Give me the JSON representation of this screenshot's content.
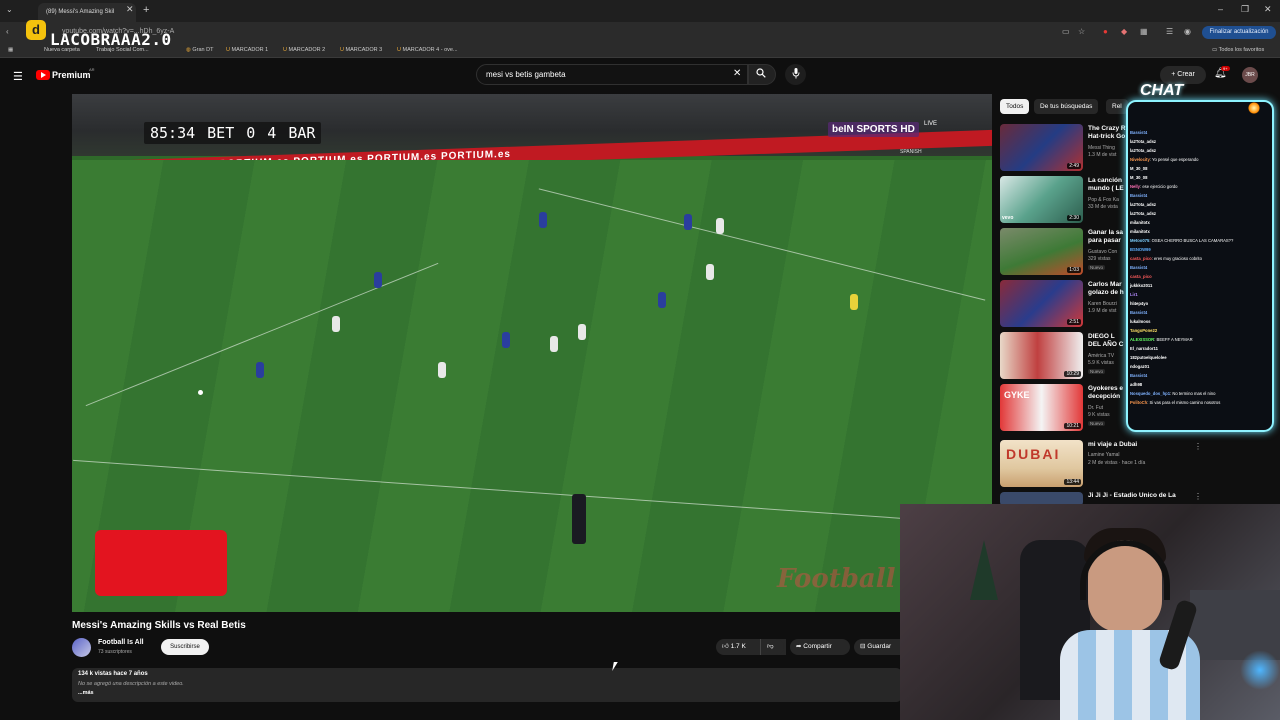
{
  "browser": {
    "tab_title": "(89) Messi's Amazing Skil",
    "url": "youtube.com/watch?v=...hDh_6yz-A",
    "update_button": "Finalizar actualización",
    "bookmarks": [
      {
        "label": "Nueva carpeta"
      },
      {
        "label": "Trabajo Social Com..."
      },
      {
        "label": "Gran DT"
      },
      {
        "label": "MARCADOR 1"
      },
      {
        "label": "MARCADOR 2"
      },
      {
        "label": "MARCADOR 3"
      },
      {
        "label": "MARCADOR 4 - ove..."
      }
    ],
    "all_bookmarks": "Todos los favoritos"
  },
  "stream": {
    "logo_letter": "d",
    "name": "LACOBRAAA2.0"
  },
  "header": {
    "brand": "Premium",
    "country": "AR",
    "search_value": "mesi vs betis gambeta",
    "create_label": "Crear",
    "notification_count": "9+",
    "avatar_initials": "JBR"
  },
  "video": {
    "scoreboard": {
      "time": "85:34",
      "home": "BET",
      "home_score": "0",
      "away_score": "4",
      "away": "BAR"
    },
    "broadcaster": "beIN SPORTS HD",
    "broadcaster_live": "LIVE",
    "broadcaster_sub": "SPANISH",
    "adboard": "PORTIUM.es    PORTIUM.es    PORTIUM.es    PORTIUM.es    PORTIUM.es    PORTIUM.es",
    "watermark": "Football",
    "title": "Messi's Amazing Skills vs Real Betis",
    "channel": "Football Is All",
    "subscribers": "73 suscriptores",
    "subscribe_label": "Suscribirse",
    "likes": "1.7 K",
    "share_label": "Compartir",
    "save_label": "Guardar",
    "stats": "134 k vistas  hace 7 años",
    "description": "No se agregó una descripción a este video.",
    "more": "...más"
  },
  "sidebar": {
    "chips": [
      "Todos",
      "De tus búsquedas",
      "Rel"
    ],
    "items": [
      {
        "title": "The Crazy R",
        "title2": "Hat-trick Go",
        "meta": "Messi Thing",
        "meta2": "1.3 M de vist",
        "duration": "2:49",
        "badge": ""
      },
      {
        "title": "La canción",
        "title2": "mundo ( LE",
        "meta": "Pop & Fox Ka",
        "meta2": "33 M de vista",
        "duration": "2:30",
        "badge": ""
      },
      {
        "title": "Ganar la sa",
        "title2": "para pasar",
        "meta": "Gustavo Con",
        "meta2": "329 vistas",
        "duration": "1:03",
        "badge": "Nuevo"
      },
      {
        "title": "Carlos Mar",
        "title2": "golazo de h",
        "meta": "Karen Bourzi",
        "meta2": "1.9 M de vist",
        "duration": "2:51",
        "badge": ""
      },
      {
        "title": "DIEGO L",
        "title2": "DEL AÑO C",
        "meta": "América TV",
        "meta2": "5.9 K vistas",
        "duration": "10:29",
        "badge": "Nuevo"
      },
      {
        "title": "Gyokeres e",
        "title2": "decepción",
        "meta": "Dr. Fut",
        "meta2": "9 K vistas",
        "duration": "10:21",
        "badge": "Nuevo"
      },
      {
        "title": "mi viaje a Dubai",
        "title2": "",
        "meta": "Lamine Yamal",
        "meta2": "2 M de vistas · hace 1 día",
        "duration": "13:44",
        "badge": ""
      },
      {
        "title": "Ji Ji Ji - Estadio Único de La",
        "title2": "",
        "meta": "",
        "meta2": "",
        "duration": "",
        "badge": ""
      }
    ]
  },
  "chat": {
    "title": "CHAT",
    "messages": [
      {
        "user": "Bassist4",
        "msg": "",
        "color": "#7fb2ff"
      },
      {
        "user": "la2Tota_adsz",
        "msg": "",
        "color": "#ffffff"
      },
      {
        "user": "la2Tota_adsz",
        "msg": "",
        "color": "#ffffff"
      },
      {
        "user": "Nivelocity",
        "msg": ": Yo pensé que esperando",
        "color": "#ff9a4f"
      },
      {
        "user": "M_30_08",
        "msg": "",
        "color": "#ffffff"
      },
      {
        "user": "M_30_08",
        "msg": "",
        "color": "#ffffff"
      },
      {
        "user": "Nelly",
        "msg": ": ese ejercicio gordo",
        "color": "#ff6fb5"
      },
      {
        "user": "Bassist4",
        "msg": "",
        "color": "#7fb2ff"
      },
      {
        "user": "la2Tota_adsz",
        "msg": "",
        "color": "#ffffff"
      },
      {
        "user": "la2Tota_adsz",
        "msg": "",
        "color": "#ffffff"
      },
      {
        "user": "milanitotx",
        "msg": "",
        "color": "#ffffff"
      },
      {
        "user": "milanitotx",
        "msg": "",
        "color": "#ffffff"
      },
      {
        "user": "Metoo075",
        "msg": ": OSEA CHERRO BUSCA LAS CAMARAS??",
        "color": "#7fd1ff"
      },
      {
        "user": "BSNOW99",
        "msg": "",
        "color": "#5fb0ff"
      },
      {
        "user": "casta_pico",
        "msg": ": eres muy gracioso cobrito",
        "color": "#ff5c5c"
      },
      {
        "user": "Bassist4",
        "msg": "",
        "color": "#7fb2ff"
      },
      {
        "user": "casta_pico",
        "msg": "",
        "color": "#ff5c5c"
      },
      {
        "user": "jukkko2011",
        "msg": "",
        "color": "#ffffff"
      },
      {
        "user": "Lir1",
        "msg": "",
        "color": "#b58cff"
      },
      {
        "user": "hl4ep4yo",
        "msg": "",
        "color": "#ffffff"
      },
      {
        "user": "Bassist4",
        "msg": "",
        "color": "#7fb2ff"
      },
      {
        "user": "lukalmoss",
        "msg": "",
        "color": "#ffffff"
      },
      {
        "user": "TangoPone22",
        "msg": "",
        "color": "#ffe066"
      },
      {
        "user": "ALEXISSOR",
        "msg": ": BEEFF A NEYMAR",
        "color": "#64ff64"
      },
      {
        "user": "El_narrador11",
        "msg": "",
        "color": "#ffffff"
      },
      {
        "user": "182putoelquelolee",
        "msg": "",
        "color": "#ffffff"
      },
      {
        "user": "ndogaz01",
        "msg": "",
        "color": "#ffffff"
      },
      {
        "user": "Bassist4",
        "msg": "",
        "color": "#7fb2ff"
      },
      {
        "user": "adh98",
        "msg": "",
        "color": "#ffffff"
      },
      {
        "user": "Nosquedo_dos_hp1",
        "msg": ": No termino mas el nino",
        "color": "#7fb2ff"
      },
      {
        "user": "PolitoCh",
        "msg": ": Si vas para el mismo camino nosotros",
        "color": "#ff9a4f"
      }
    ]
  }
}
